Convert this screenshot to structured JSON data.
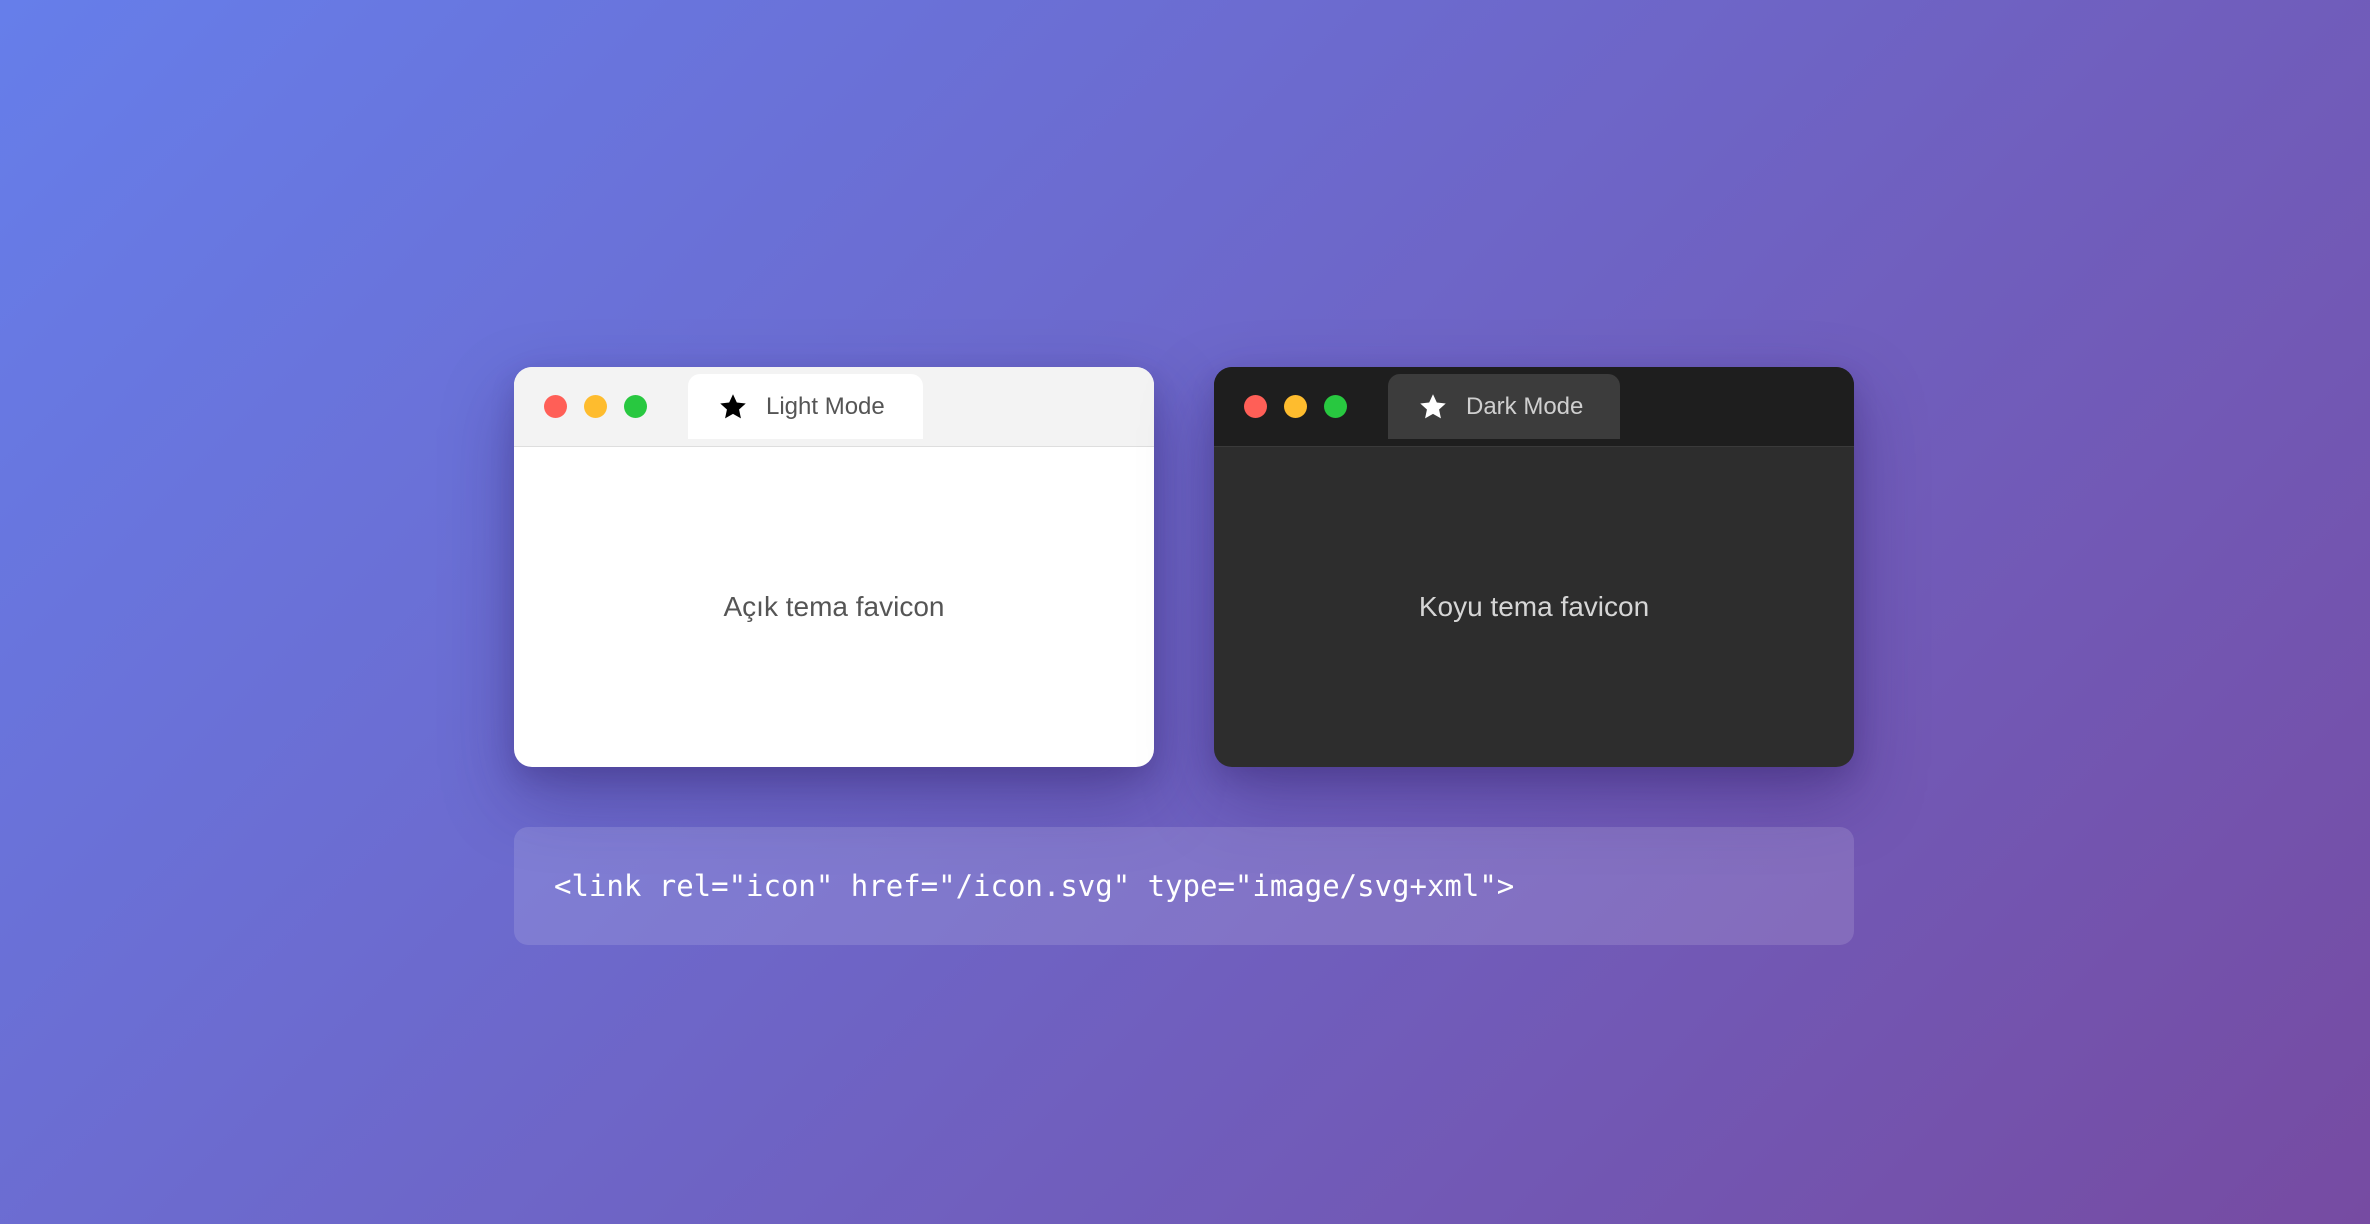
{
  "windows": {
    "light": {
      "tab_label": "Light Mode",
      "content_text": "Açık tema favicon",
      "tab_icon": "star-icon",
      "icon_color": "#000000"
    },
    "dark": {
      "tab_label": "Dark Mode",
      "content_text": "Koyu tema favicon",
      "tab_icon": "star-icon",
      "icon_color": "#ffffff"
    }
  },
  "code_snippet": "<link rel=\"icon\" href=\"/icon.svg\" type=\"image/svg+xml\">",
  "colors": {
    "background_start": "#667eea",
    "background_end": "#764ba2",
    "traffic_red": "#ff5f57",
    "traffic_yellow": "#febc2e",
    "traffic_green": "#28c840"
  }
}
